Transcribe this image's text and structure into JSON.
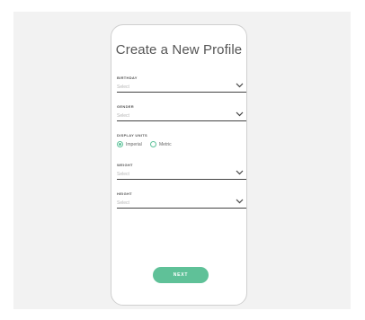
{
  "form": {
    "title": "Create a New Profile",
    "fields": [
      {
        "label": "BIRTHDAY",
        "placeholder": "Select"
      },
      {
        "label": "GENDER",
        "placeholder": "Select"
      },
      {
        "label": "WEIGHT",
        "placeholder": "Select"
      },
      {
        "label": "HEIGHT",
        "placeholder": "Select"
      }
    ],
    "units": {
      "label": "DISPLAY UNITS",
      "options": [
        "Imperial",
        "Metric"
      ],
      "selected": "Imperial"
    },
    "next_label": "NEXT"
  },
  "colors": {
    "accent": "#5fc198",
    "background": "#f2f2f2"
  },
  "icons": {
    "dropdown": "chevron-down-icon",
    "radio_selected": "radio-selected-icon",
    "radio_unselected": "radio-unselected-icon"
  }
}
